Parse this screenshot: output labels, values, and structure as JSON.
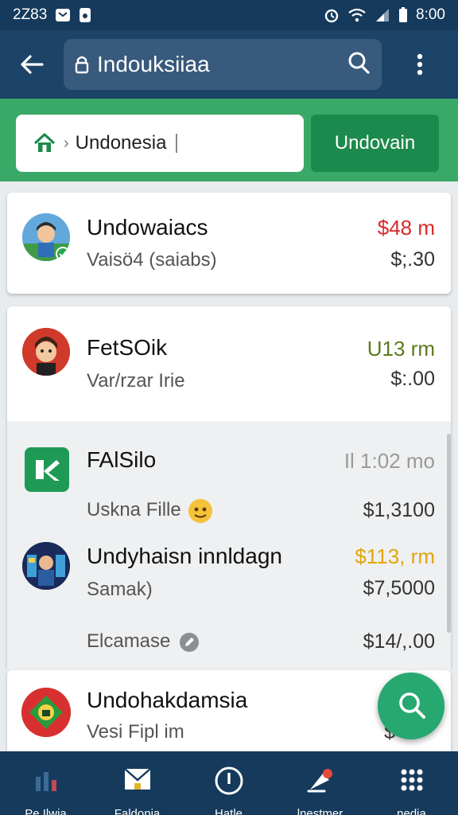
{
  "status_bar": {
    "time_left": "2Z83",
    "time_right": "8:00"
  },
  "header": {
    "search_text": "Indouksiiaa"
  },
  "filter": {
    "location_text": "Undonesia",
    "button_label": "Undovain"
  },
  "list": [
    {
      "title": "Undowaiacs",
      "subtitle": "Vaisö4 (saiabs)",
      "amount": "$48 m",
      "amount_color": "#d92a2a",
      "price": "$;.30"
    },
    {
      "title": "FetSOik",
      "subtitle": "Var/rzar Irie",
      "amount": "U13 rm",
      "amount_color": "#5d7a1c",
      "price": "$:.00"
    },
    {
      "title": "FAlSilo",
      "subtitle": "Uskna Fille",
      "amount": "Il 1:02 mo",
      "amount_color": "#9a9a9a",
      "price": "$1,3100"
    },
    {
      "title": "Undyhaisn innldagn",
      "subtitle": "Samak)",
      "amount": "$113, rm",
      "amount_color": "#e2a50c",
      "price": "$7,5000"
    },
    {
      "title": "",
      "subtitle": "Elcamase",
      "amount": "",
      "amount_color": "#9a9a9a",
      "price": "$14/,.00"
    },
    {
      "title": "Undohakdamsia",
      "subtitle": "Vesi Fipl im",
      "amount": "G",
      "amount_color": "#b8a018",
      "price": "$"
    }
  ],
  "bottom_nav": [
    {
      "label": "Pe Ilwia"
    },
    {
      "label": "Faldonia"
    },
    {
      "label": "Hatle"
    },
    {
      "label": "lnestmer"
    },
    {
      "label": "nedia"
    }
  ],
  "colors": {
    "status_bg": "#153a5c",
    "app_bar_bg": "#1b4468",
    "filter_bg": "#3aa866",
    "button_bg": "#1c8a4c",
    "fab_bg": "#27a871"
  },
  "icons": {
    "back": "arrow-left-icon",
    "lock": "lock-icon",
    "search": "search-icon",
    "more": "more-vert-icon",
    "home": "home-icon",
    "fab": "search-icon"
  }
}
